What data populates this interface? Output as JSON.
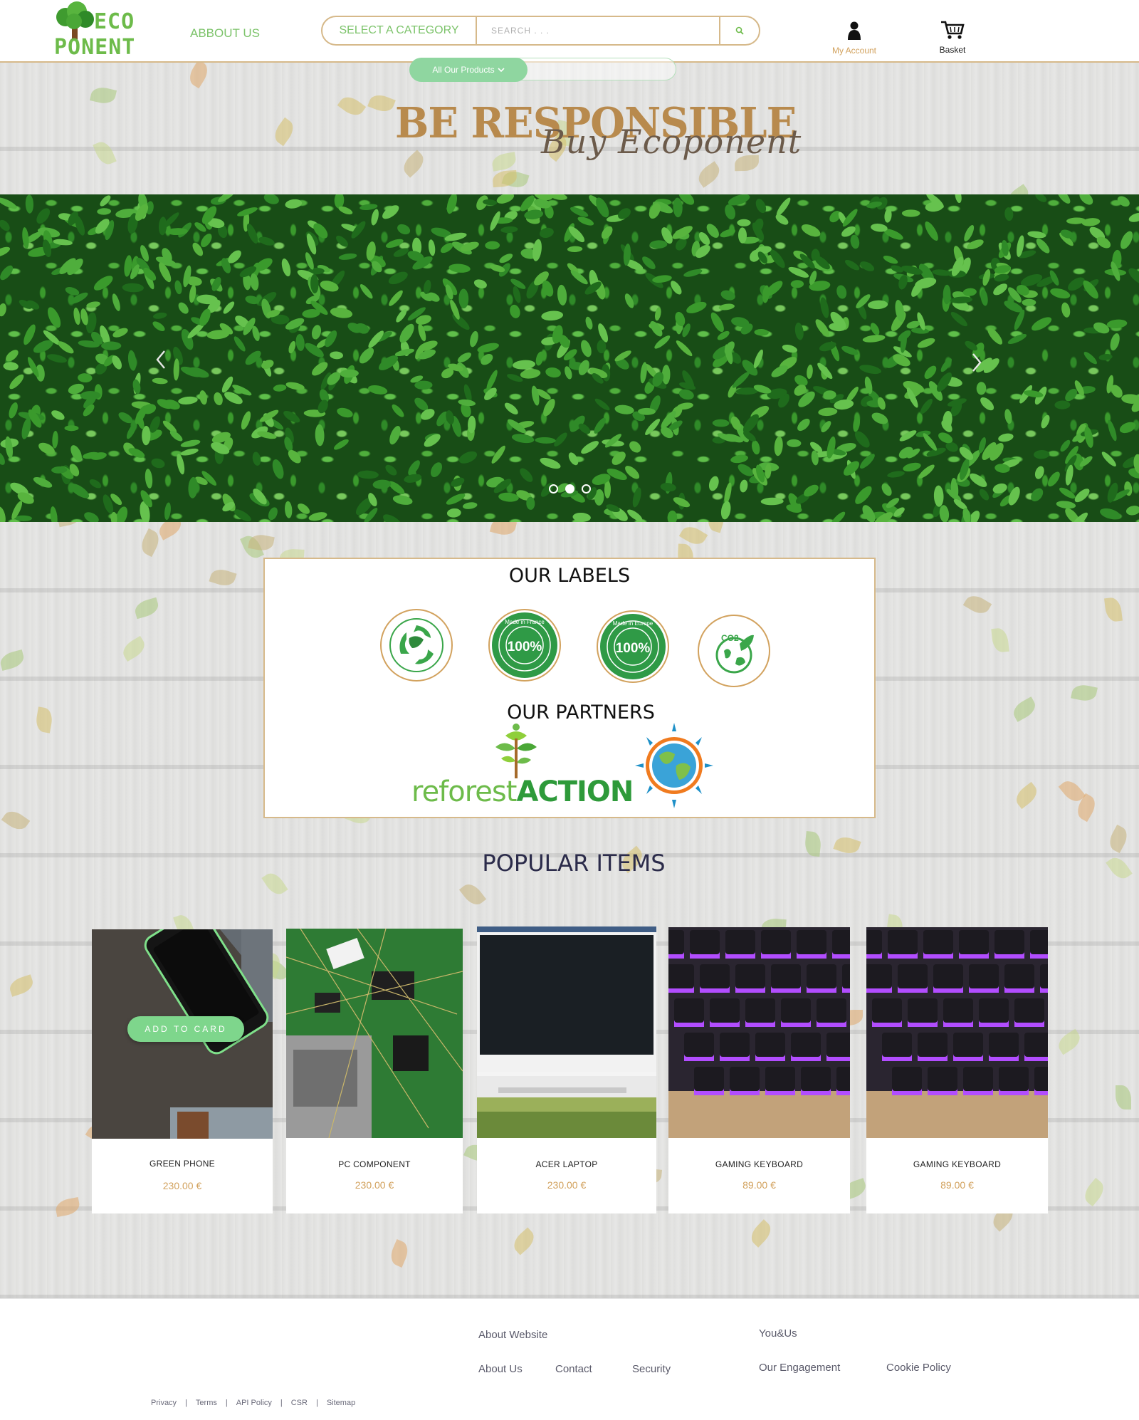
{
  "brand": {
    "logo_line1": "ECO",
    "logo_line2": "PONENT",
    "colors": {
      "green": "#6dbb4a",
      "gold": "#d2a25e",
      "pill": "#8fd6a0"
    }
  },
  "header": {
    "about_label": "ABBOUT US",
    "category_label": "SELECT A CATEGORY",
    "search_placeholder": "SEARCH . . .",
    "search_icon": "search-icon",
    "account_label": "My Account",
    "basket_label": "Basket",
    "all_products_label": "All Our Products"
  },
  "tagline": {
    "main": "BE RESPONSIBLE",
    "script": "Buy Ecoponent"
  },
  "hero": {
    "slides": 3,
    "active_slide": 2
  },
  "labels": {
    "title": "OUR LABELS",
    "badges": [
      {
        "name": "recycle-badge"
      },
      {
        "name": "made-in-france-badge",
        "value": "100%",
        "ring_text": "Made in France"
      },
      {
        "name": "made-in-europe-badge",
        "value": "100%",
        "ring_text": "Made in Europe"
      },
      {
        "name": "co2-badge",
        "text": "CO2"
      }
    ],
    "partners_title": "OUR PARTNERS",
    "partners": [
      {
        "name": "reforestaction-logo",
        "text_a": "reforest",
        "text_b": "ACTION"
      },
      {
        "name": "earth-partner-logo"
      }
    ]
  },
  "popular": {
    "title": "POPULAR ITEMS",
    "add_to_cart_label": "ADD TO CARD",
    "items": [
      {
        "name": "GREEN PHONE",
        "price": "230.00 €"
      },
      {
        "name": "PC COMPONENT",
        "price": "230.00 €"
      },
      {
        "name": "ACER LAPTOP",
        "price": "230.00 €"
      },
      {
        "name": "GAMING KEYBOARD",
        "price": "89.00 €"
      },
      {
        "name": "GAMING KEYBOARD",
        "price": "89.00 €"
      }
    ]
  },
  "footer": {
    "about_website": "About Website",
    "links_left": [
      "About Us",
      "Contact",
      "Security"
    ],
    "you_us": "You&Us",
    "links_right": [
      "Our Engagement",
      "Cookie Policy"
    ],
    "legal": [
      "Privacy",
      "Terms",
      "API Policy",
      "CSR",
      "Sitemap"
    ]
  }
}
